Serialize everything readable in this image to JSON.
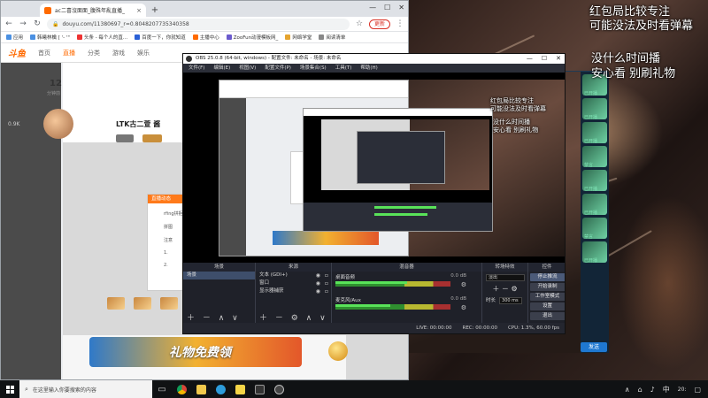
{
  "browser": {
    "tab_title": "ac二喜沒面面_腹殊年亂直播_",
    "tab_close": "×",
    "new_tab": "+",
    "win_min": "—",
    "win_max": "☐",
    "win_close": "✕",
    "address": "douyu.com/11380697_r=0.8048207735340358",
    "update_label": "更新",
    "bookmarks": [
      "应用",
      "韩曦林檎 [ '- '\"",
      "头条 - 每个人的直...",
      "百度一下，你就知道",
      "主播中心",
      "ZooFun动漫模板网_",
      "网络学堂",
      "阅读清单"
    ]
  },
  "site": {
    "logo": "斗鱼",
    "nav": [
      "首页",
      "直播",
      "分类",
      "游戏",
      "娱乐"
    ],
    "room_num": "12",
    "room_sub": "分钟前",
    "room_title": "LTK古二萱 酱",
    "rail_stat": "0.9K",
    "popup_header": "直播动态",
    "popup_lines": [
      "rfing拼拒",
      "拼图",
      "注意",
      "1.",
      "2.",
      "3."
    ],
    "gift_banner": "礼物免费领"
  },
  "overlay": {
    "line1": "红包局比较专注",
    "line2": "可能没法及时看弹幕",
    "line3": "没什么时间播",
    "line4": "安心看 别刷礼物"
  },
  "obs": {
    "title": "OBS 25.0.8 (64-bit, windows) - 配置文件: 未命名 - 场景: 未命名",
    "menu": [
      "文件(F)",
      "编辑(E)",
      "视图(V)",
      "配置文件(P)",
      "场景集合(S)",
      "工具(T)",
      "帮助(H)"
    ],
    "dock_titles": [
      "场景",
      "来源",
      "混音器",
      "转场特效",
      "控件"
    ],
    "scenes": [
      "场景"
    ],
    "sources": [
      "文本 (GDI+)",
      "窗口",
      "显示器捕获"
    ],
    "mixer": [
      {
        "name": "桌面音频",
        "value": "0.0 dB",
        "level": 0.62
      },
      {
        "name": "麦克风/Aux",
        "value": "0.0 dB",
        "level": 0.48
      }
    ],
    "transition": {
      "effect": "淡出",
      "duration_label": "时长",
      "duration": "300 ms"
    },
    "controls": [
      "停止推流",
      "开始录制",
      "工作室模式",
      "设置",
      "退出"
    ],
    "status": [
      "LIVE: 00:00:00",
      "REC: 00:00:00",
      "CPU: 1.3%, 60.00 fps"
    ],
    "dock_add": "＋ －  ∧ ∨"
  },
  "client": {
    "badges": [
      "已开播",
      "已开播",
      "已开播",
      "禁言",
      "已开播",
      "已开播",
      "禁言",
      "已开播"
    ],
    "send_label": "发送"
  },
  "taskbar": {
    "search_placeholder": "在这里输入你要搜索的内容",
    "tray_time": "20:"
  },
  "colors": {
    "douyu_orange": "#ff6a00",
    "obs_bg": "#2b2e38",
    "meter_green": "#59e359"
  }
}
